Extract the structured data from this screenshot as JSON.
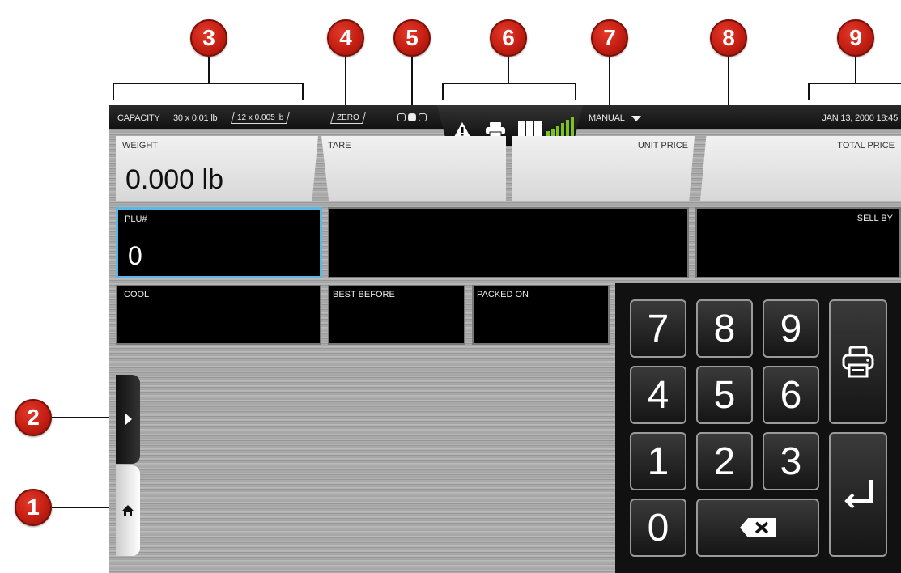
{
  "callouts": [
    "1",
    "2",
    "3",
    "4",
    "5",
    "6",
    "7",
    "8",
    "9"
  ],
  "statusbar": {
    "capacity_label": "CAPACITY",
    "capacity_1": "30 x 0.01 lb",
    "capacity_2": "12 x 0.005 lb",
    "zero": "ZERO",
    "mode": "MANUAL",
    "datetime": "JAN 13, 2000 18:45"
  },
  "fields": {
    "weight_label": "WEIGHT",
    "weight_value": "0.000 lb",
    "tare_label": "TARE",
    "unit_price_label": "UNIT PRICE",
    "total_price_label": "TOTAL PRICE",
    "plu_label": "PLU#",
    "plu_value": "0",
    "sell_by_label": "SELL BY",
    "cool_label": "COOL",
    "best_before_label": "BEST BEFORE",
    "packed_on_label": "PACKED ON"
  },
  "keypad": {
    "keys": [
      "7",
      "8",
      "9",
      "4",
      "5",
      "6",
      "1",
      "2",
      "3",
      "0"
    ]
  },
  "icons": {
    "warning": "warning-icon",
    "printer": "printer-icon",
    "grid": "grid-icon",
    "signal": "signal-icon",
    "backspace": "backspace-icon",
    "enter": "enter-icon",
    "home": "home-icon",
    "expand": "chevron-right-icon"
  },
  "colors": {
    "callout": "#c41e12",
    "signal": "#7dc21e",
    "selected_border": "#5ab8e6"
  }
}
